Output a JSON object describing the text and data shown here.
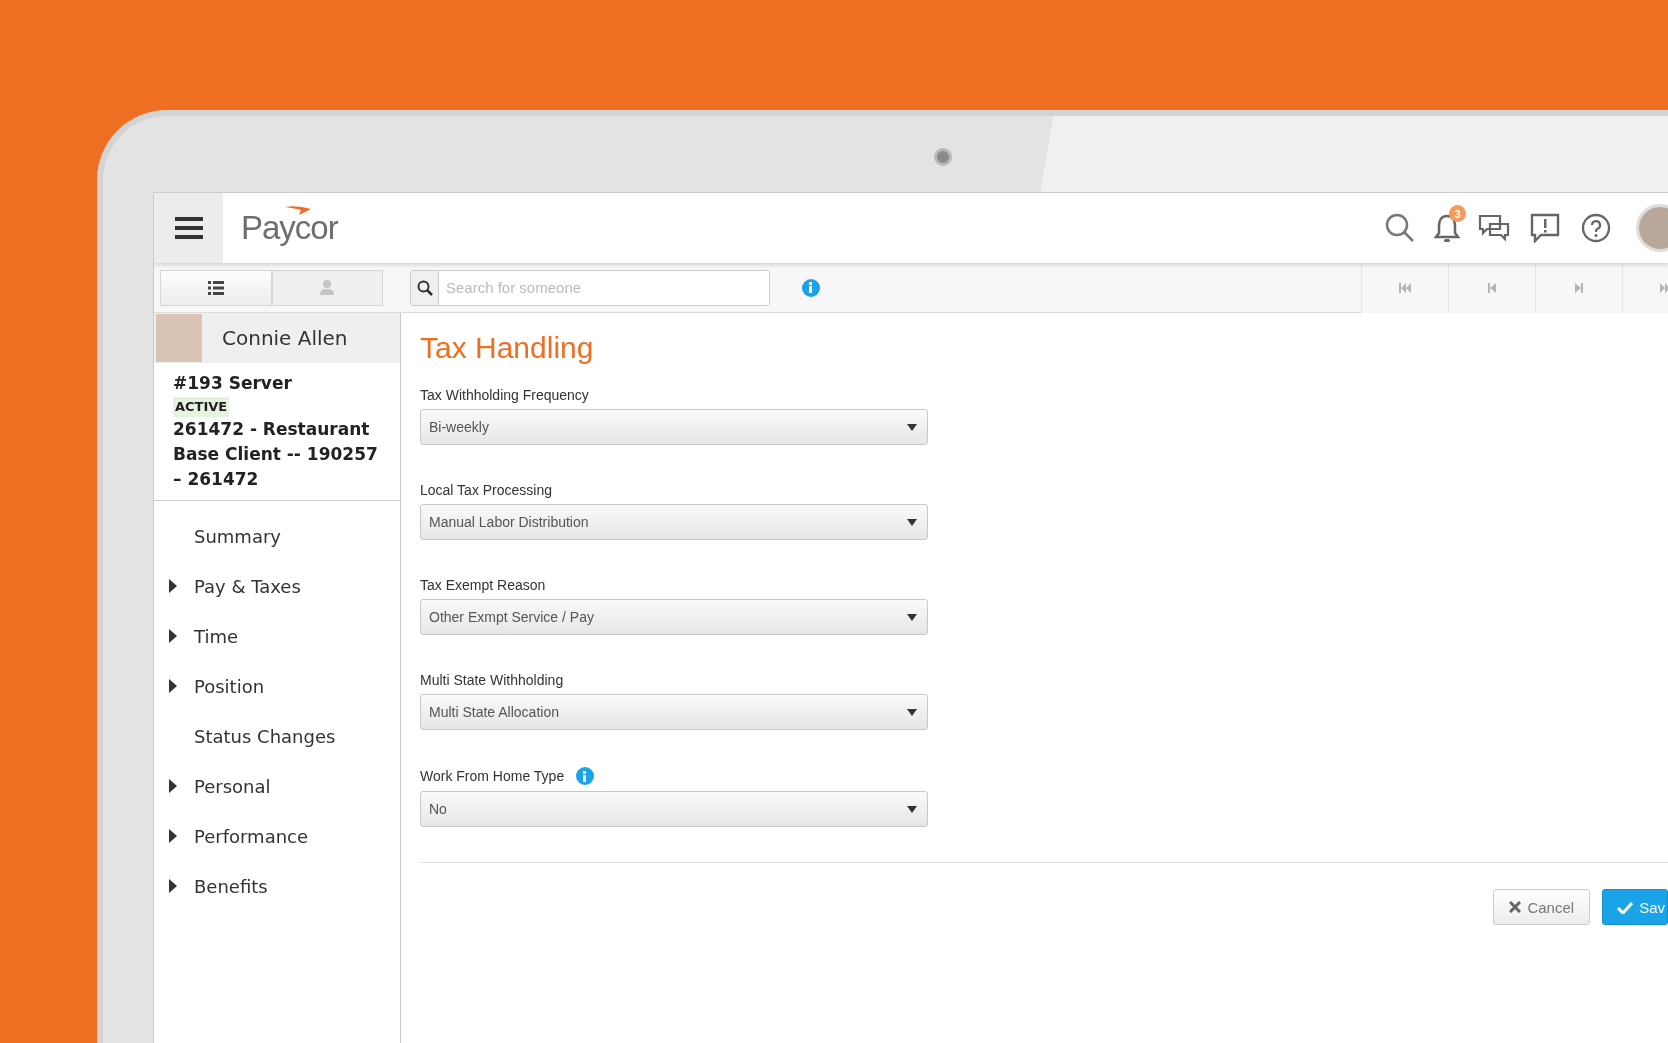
{
  "header": {
    "logo": "Paycor",
    "notification_count": "3"
  },
  "toolbar": {
    "view_tabs": [
      {
        "kind": "list",
        "selected": true
      },
      {
        "kind": "person",
        "selected": false
      }
    ],
    "search": {
      "placeholder": "Search for someone"
    }
  },
  "employee": {
    "name": "Connie Allen",
    "position": "#193 Server",
    "status": "ACTIVE",
    "client": "261472 - Restaurant Base Client -- 190257 – 261472"
  },
  "nav": [
    {
      "label": "Summary",
      "expandable": false
    },
    {
      "label": "Pay & Taxes",
      "expandable": true
    },
    {
      "label": "Time",
      "expandable": true
    },
    {
      "label": "Position",
      "expandable": true
    },
    {
      "label": "Status Changes",
      "expandable": false
    },
    {
      "label": "Personal",
      "expandable": true
    },
    {
      "label": "Performance",
      "expandable": true
    },
    {
      "label": "Benefits",
      "expandable": true
    }
  ],
  "form": {
    "title": "Tax Handling",
    "fields": [
      {
        "label": "Tax Withholding Frequency",
        "value": "Bi-weekly",
        "info": false
      },
      {
        "label": "Local Tax Processing",
        "value": "Manual Labor Distribution",
        "info": false
      },
      {
        "label": "Tax Exempt Reason",
        "value": "Other Exmpt Service / Pay",
        "info": false
      },
      {
        "label": "Multi State Withholding",
        "value": "Multi State Allocation",
        "info": false
      },
      {
        "label": "Work From Home Type",
        "value": "No",
        "info": true
      }
    ],
    "buttons": [
      {
        "kind": "cancel",
        "label": "Cancel"
      },
      {
        "kind": "save",
        "label": "Sav"
      }
    ]
  }
}
